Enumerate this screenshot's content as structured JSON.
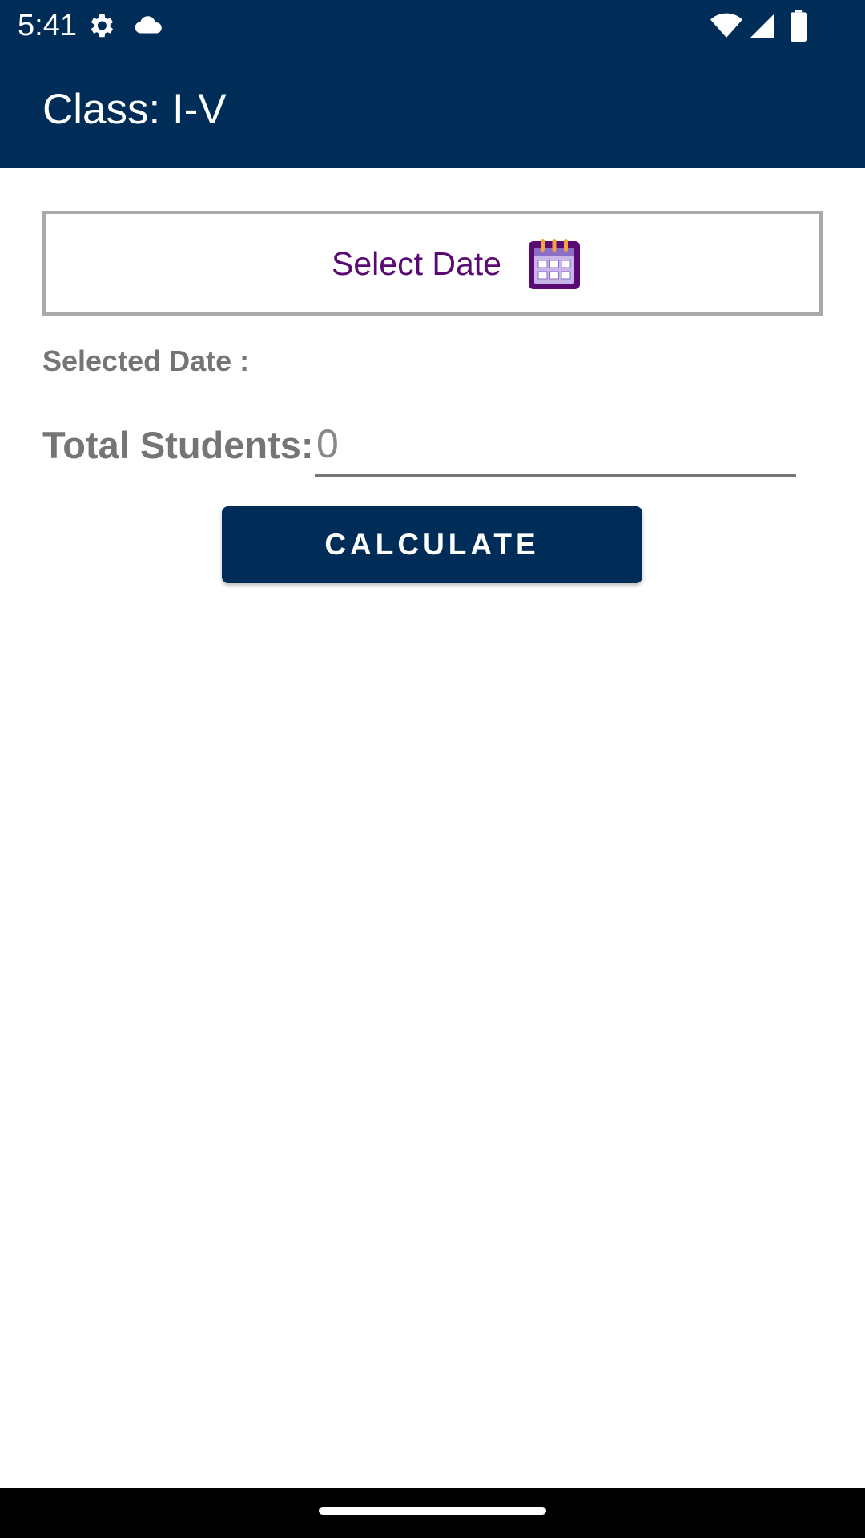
{
  "status_bar": {
    "time": "5:41",
    "left_icons": [
      "gear-icon",
      "cloud-icon"
    ],
    "right_icons": [
      "wifi-icon",
      "signal-icon",
      "battery-icon"
    ]
  },
  "app_bar": {
    "title": "Class: I-V",
    "background_color": "#002d57"
  },
  "select_date": {
    "label": "Select Date",
    "icon": "calendar-icon",
    "label_color": "#5a0a73"
  },
  "selected_date": {
    "label": "Selected Date :"
  },
  "total_students": {
    "label": "Total Students:",
    "value": "0"
  },
  "actions": {
    "calculate_label": "CALCULATE"
  }
}
